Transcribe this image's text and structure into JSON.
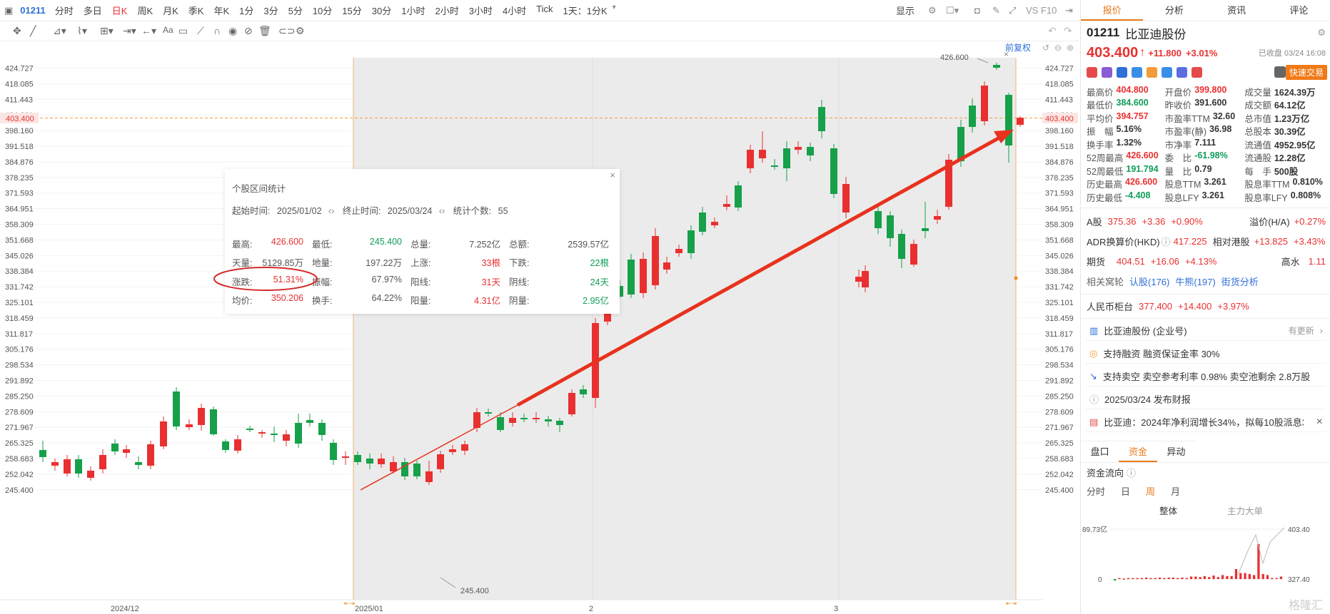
{
  "topbar": {
    "code": "01211",
    "timeframes": [
      "分时",
      "多日",
      "日K",
      "周K",
      "月K",
      "季K",
      "年K",
      "1分",
      "3分",
      "5分",
      "10分",
      "15分",
      "30分",
      "1小时",
      "2小时",
      "3小时",
      "4小时",
      "Tick",
      "1天：1分K"
    ],
    "active": "日K",
    "display": "显示",
    "vs": "VS F10"
  },
  "chart": {
    "fuquan": "前复权",
    "y_ticks": [
      "424.727",
      "418.085",
      "411.443",
      "404.801",
      "398.160",
      "391.518",
      "384.876",
      "378.235",
      "371.593",
      "364.951",
      "358.309",
      "351.668",
      "345.026",
      "338.384",
      "331.742",
      "325.101",
      "318.459",
      "311.817",
      "305.176",
      "298.534",
      "291.892",
      "285.250",
      "278.609",
      "271.967",
      "265.325",
      "258.683",
      "252.042",
      "245.400"
    ],
    "price_tag": "403.400",
    "x_labels": [
      "2024/12",
      "2025/01",
      "2",
      "3"
    ],
    "high_label": "426.600",
    "low_label": "245.400",
    "colors": {
      "up": "#e93030",
      "down": "#16a04a",
      "line": "#e8321e"
    }
  },
  "panel": {
    "title": "个股区间统计",
    "start_label": "起始时间:",
    "start": "2025/01/02",
    "end_label": "终止时间:",
    "end": "2025/03/24",
    "count_label": "统计个数:",
    "count": "55",
    "rows": [
      [
        [
          "最高:",
          "426.600",
          "up"
        ],
        [
          "最低:",
          "245.400",
          "dn"
        ],
        [
          "总量:",
          "7.252亿",
          ""
        ],
        [
          "总额:",
          "2539.57亿",
          ""
        ]
      ],
      [
        [
          "天量:",
          "5129.85万",
          ""
        ],
        [
          "地量:",
          "197.22万",
          ""
        ],
        [
          "上涨:",
          "33根",
          "up"
        ],
        [
          "下跌:",
          "22根",
          "dn"
        ]
      ],
      [
        [
          "涨跌:",
          "51.31%",
          "up"
        ],
        [
          "振幅:",
          "67.97%",
          ""
        ],
        [
          "阳线:",
          "31天",
          "up"
        ],
        [
          "阴线:",
          "24天",
          "dn"
        ]
      ],
      [
        [
          "均价:",
          "350.206",
          "up"
        ],
        [
          "换手:",
          "64.22%",
          ""
        ],
        [
          "阳量:",
          "4.31亿",
          "up"
        ],
        [
          "阴量:",
          "2.95亿",
          "dn"
        ]
      ]
    ]
  },
  "right": {
    "tabs": [
      "报价",
      "分析",
      "资讯",
      "评论"
    ],
    "code": "01211",
    "name": "比亚迪股份",
    "price": "403.400",
    "change": "+11.800",
    "pct": "+3.01%",
    "closed": "已收盘 03/24 16:08",
    "quick_trade": "快速交易",
    "stats": [
      [
        [
          "最高价",
          "404.800",
          "up"
        ],
        [
          "开盘价",
          "399.800",
          "up"
        ],
        [
          "成交量",
          "1624.39万",
          ""
        ]
      ],
      [
        [
          "最低价",
          "384.600",
          "dn"
        ],
        [
          "昨收价",
          "391.600",
          ""
        ],
        [
          "成交额",
          "64.12亿",
          ""
        ]
      ],
      [
        [
          "平均价",
          "394.757",
          "up"
        ],
        [
          "市盈率TTM",
          "32.60",
          ""
        ],
        [
          "总市值",
          "1.23万亿",
          ""
        ]
      ],
      [
        [
          "振　幅",
          "5.16%",
          ""
        ],
        [
          "市盈率(静)",
          "36.98",
          ""
        ],
        [
          "总股本",
          "30.39亿",
          ""
        ]
      ],
      [
        [
          "换手率",
          "1.32%",
          ""
        ],
        [
          "市净率",
          "7.111",
          ""
        ],
        [
          "流通值",
          "4952.95亿",
          ""
        ]
      ],
      [
        [
          "52周最高",
          "426.600",
          "up"
        ],
        [
          "委　比",
          "-61.98%",
          "dn"
        ],
        [
          "流通股",
          "12.28亿",
          ""
        ]
      ],
      [
        [
          "52周最低",
          "191.794",
          "dn"
        ],
        [
          "量　比",
          "0.79",
          ""
        ],
        [
          "每　手",
          "500股",
          ""
        ]
      ],
      [
        [
          "历史最高",
          "426.600",
          "up"
        ],
        [
          "股息TTM",
          "3.261",
          ""
        ],
        [
          "股息率TTM",
          "0.810%",
          ""
        ]
      ],
      [
        [
          "历史最低",
          "-4.408",
          "dn"
        ],
        [
          "股息LFY",
          "3.261",
          ""
        ],
        [
          "股息率LFY",
          "0.808%",
          ""
        ]
      ]
    ],
    "a_share": [
      "A股",
      "375.36",
      "+3.36",
      "+0.90%",
      "溢价(H/A)",
      "+0.27%"
    ],
    "adr": [
      "ADR换算价(HKD)",
      "417.225",
      "相对港股",
      "+13.825",
      "+3.43%"
    ],
    "futures": [
      "期货",
      "404.51",
      "+16.06",
      "+4.13%",
      "高水",
      "1.11"
    ],
    "warrants": [
      "相关窝轮",
      "认股(176)",
      "牛熊(197)",
      "街货分析"
    ],
    "rmb": [
      "人民币柜台",
      "377.400",
      "+14.400",
      "+3.97%"
    ],
    "cards": [
      "比亚迪股份 (企业号)",
      "支持融资 融资保证金率 30%",
      "支持卖空 卖空参考利率 0.98% 卖空池剩余 2.8万股",
      "2025/03/24 发布财报",
      "比亚迪：2024年净利润增长34%，拟每10股派息3..."
    ],
    "card_more": "有更新",
    "subtabs": [
      "盘口",
      "资金",
      "异动"
    ],
    "flow_title": "资金流向",
    "periods": [
      "分时",
      "日",
      "周",
      "月"
    ],
    "flow_tabs": [
      "整体",
      "主力大单"
    ],
    "flow_y": [
      "89.73亿",
      "0"
    ],
    "flow_price": [
      "403.40",
      "327.40"
    ],
    "flow_bars": [
      -0.03,
      0.02,
      0.01,
      0.02,
      0.02,
      0.02,
      0.02,
      0.03,
      0.02,
      0.02,
      0.03,
      0.02,
      0.03,
      0.03,
      0.02,
      0.03,
      0.02,
      0.05,
      0.05,
      0.04,
      0.06,
      0.04,
      0.07,
      0.04,
      0.08,
      0.06,
      0.06,
      0.2,
      0.12,
      0.12,
      0.1,
      0.08,
      0.7,
      0.1,
      0.08,
      0.02,
      0.02,
      0.05
    ],
    "watermark": "格隆汇"
  }
}
